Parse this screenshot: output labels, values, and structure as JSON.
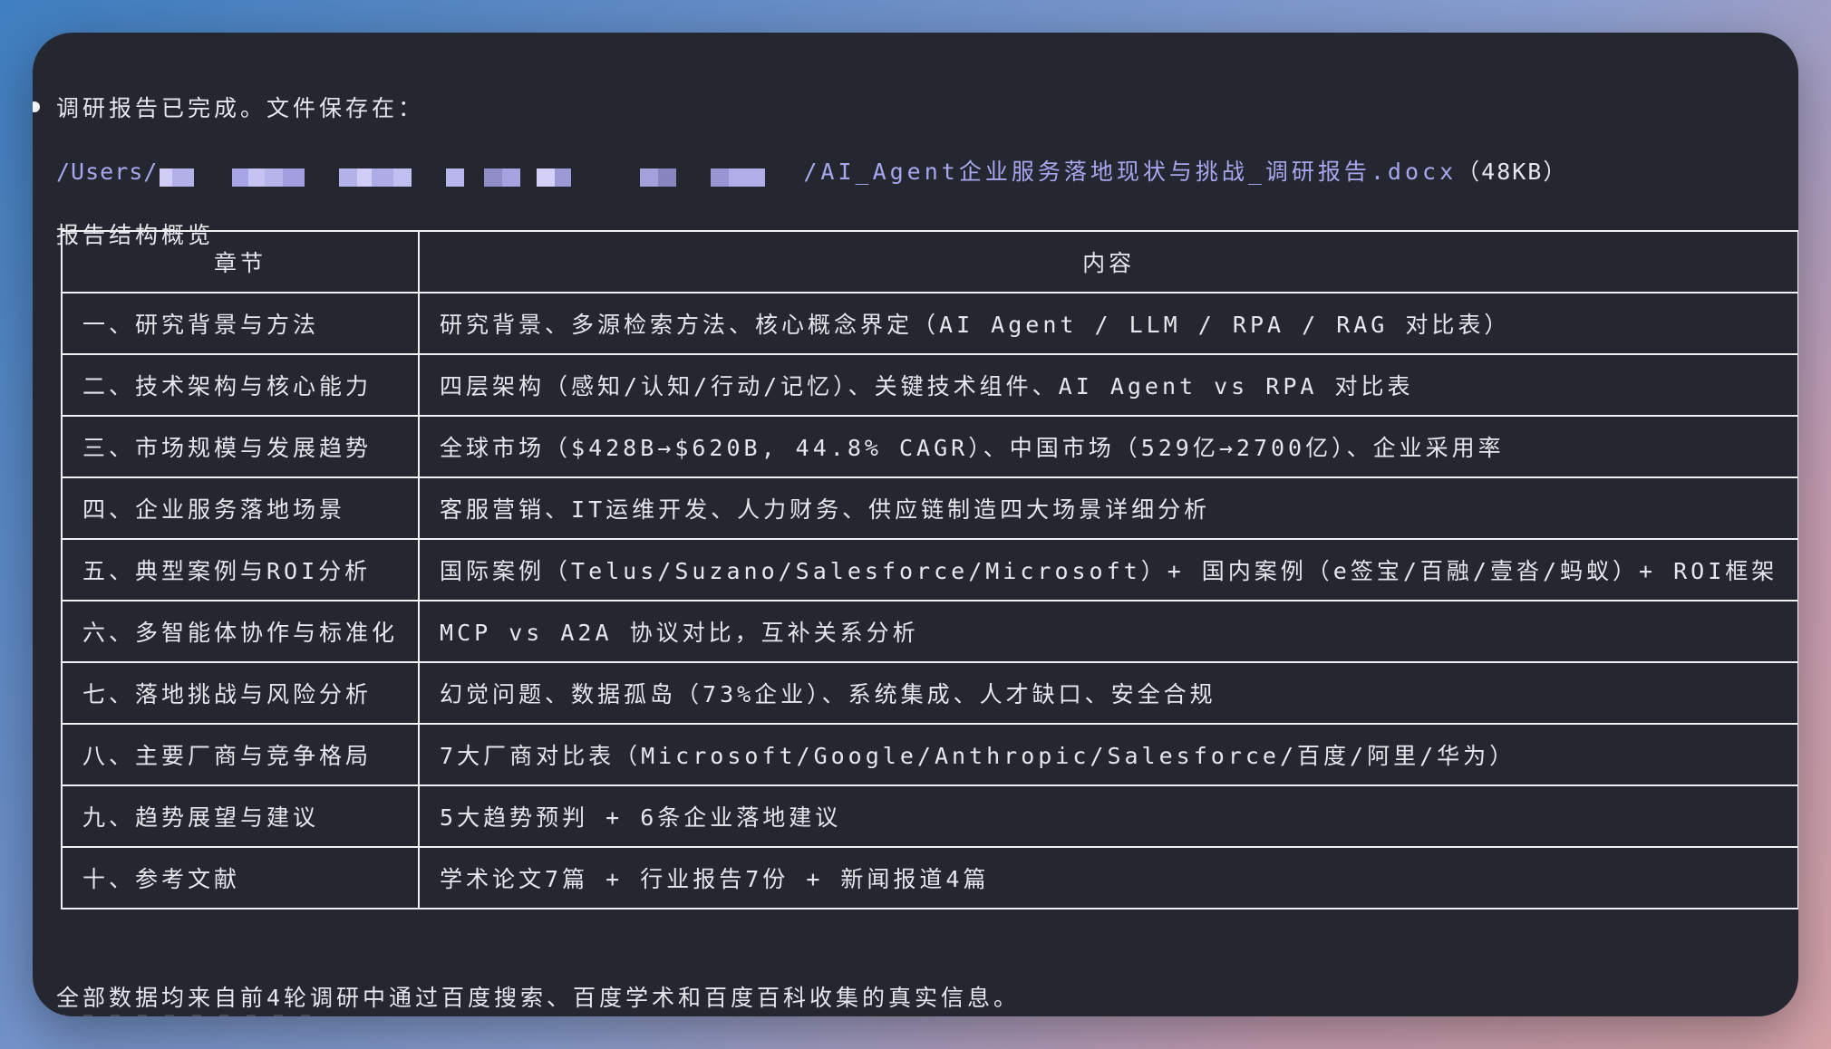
{
  "message": {
    "status": "调研报告已完成。文件保存在：",
    "path_prefix": "/Users/",
    "path_suffix": "/AI_Agent企业服务落地现状与挑战_调研报告.docx",
    "file_size": "（48KB）",
    "overview_title": "报告结构概览",
    "footer": "全部数据均来自前4轮调研中通过百度搜索、百度学术和百度百科收集的真实信息。"
  },
  "table": {
    "headers": [
      "章节",
      "内容"
    ],
    "rows": [
      {
        "chapter": "一、研究背景与方法",
        "content": "研究背景、多源检索方法、核心概念界定（AI Agent / LLM / RPA / RAG 对比表）"
      },
      {
        "chapter": "二、技术架构与核心能力",
        "content": "四层架构（感知/认知/行动/记忆）、关键技术组件、AI Agent vs RPA 对比表"
      },
      {
        "chapter": "三、市场规模与发展趋势",
        "content": "全球市场（$428B→$620B, 44.8% CAGR）、中国市场（529亿→2700亿）、企业采用率"
      },
      {
        "chapter": "四、企业服务落地场景",
        "content": "客服营销、IT运维开发、人力财务、供应链制造四大场景详细分析"
      },
      {
        "chapter": "五、典型案例与ROI分析",
        "content": "国际案例（Telus/Suzano/Salesforce/Microsoft）+ 国内案例（e签宝/百融/壹沓/蚂蚁）+ ROI框架"
      },
      {
        "chapter": "六、多智能体协作与标准化",
        "content": "MCP vs A2A 协议对比，互补关系分析"
      },
      {
        "chapter": "七、落地挑战与风险分析",
        "content": "幻觉问题、数据孤岛（73%企业）、系统集成、人才缺口、安全合规"
      },
      {
        "chapter": "八、主要厂商与竞争格局",
        "content": "7大厂商对比表（Microsoft/Google/Anthropic/Salesforce/百度/阿里/华为）"
      },
      {
        "chapter": "九、趋势展望与建议",
        "content": "5大趋势预判 + 6条企业落地建议"
      },
      {
        "chapter": "十、参考文献",
        "content": "学术论文7篇 + 行业报告7份 + 新闻报道4篇"
      }
    ]
  },
  "colors": {
    "window_bg": "#24272f",
    "path_accent": "#a9a6f0",
    "text": "#e6e7ec",
    "redaction": "#b9b6f2"
  }
}
